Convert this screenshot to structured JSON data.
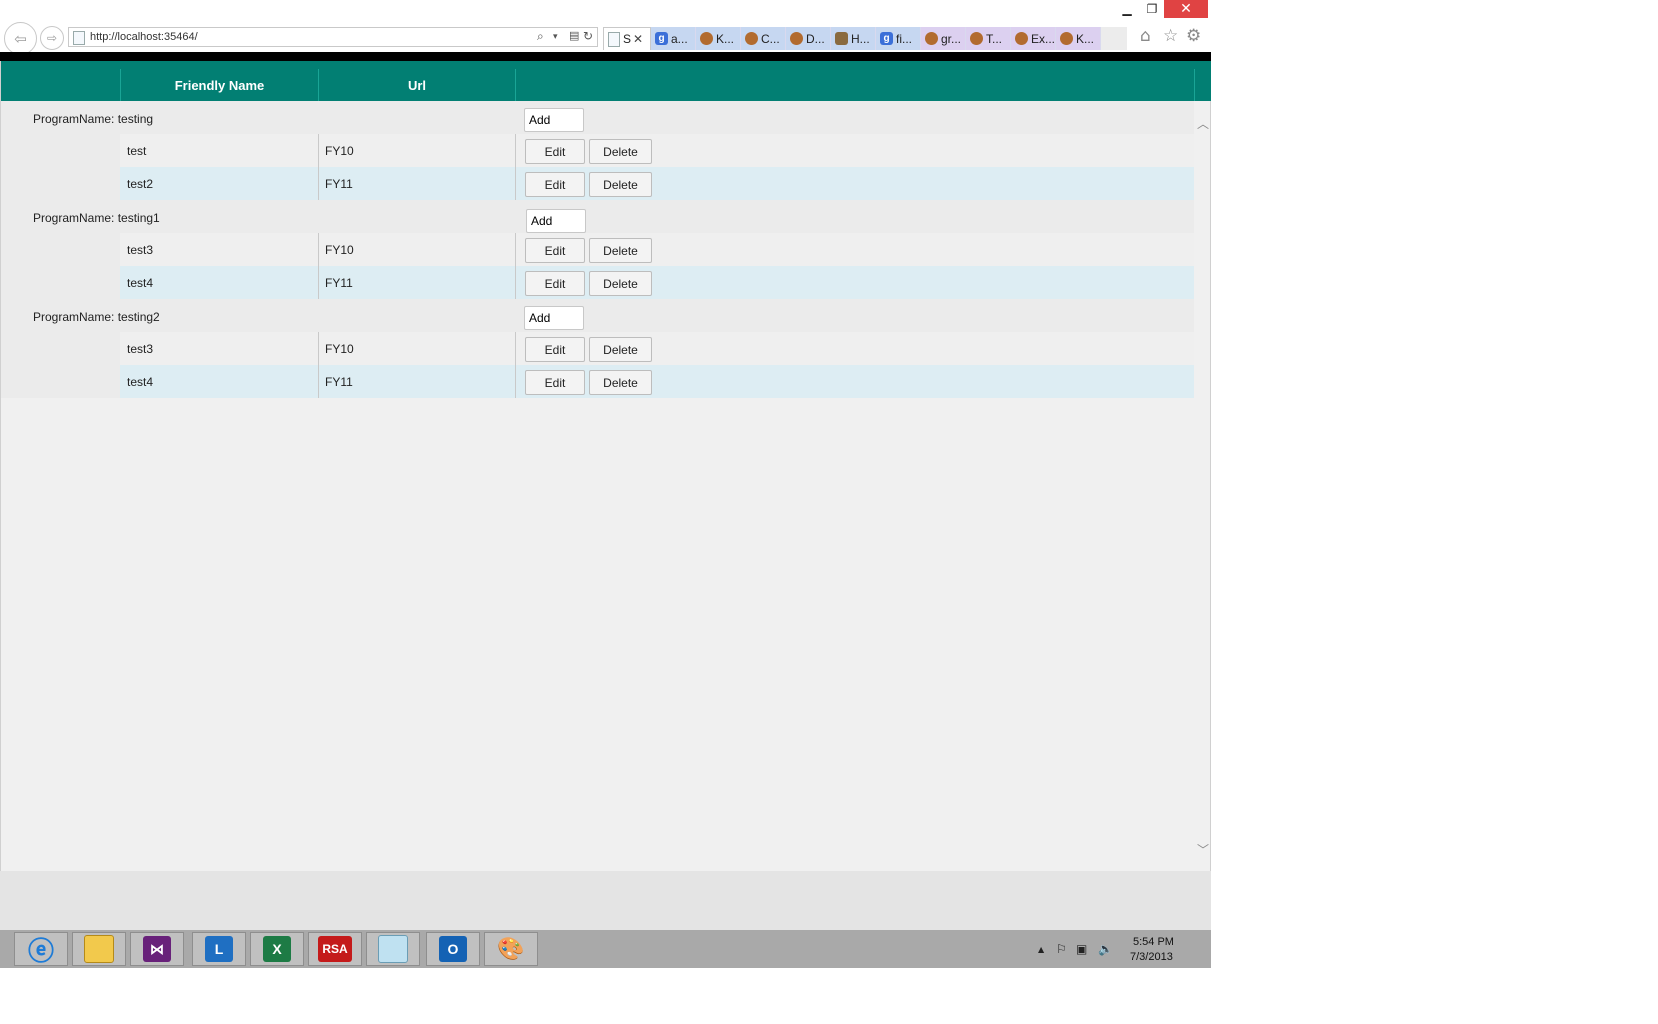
{
  "browser": {
    "url": "http://localhost:35464/",
    "tabs": [
      {
        "label": "S",
        "kind": "active"
      },
      {
        "label": "a...",
        "kind": "google"
      },
      {
        "label": "K...",
        "kind": "user"
      },
      {
        "label": "C...",
        "kind": "user"
      },
      {
        "label": "D...",
        "kind": "user"
      },
      {
        "label": "H...",
        "kind": "stack"
      },
      {
        "label": "fi...",
        "kind": "google"
      },
      {
        "label": "gr...",
        "kind": "user"
      },
      {
        "label": "T...",
        "kind": "user"
      },
      {
        "label": "Ex...",
        "kind": "user"
      },
      {
        "label": "K...",
        "kind": "user"
      }
    ],
    "colors": {
      "header": "#027f73",
      "alt_row": "#ddedf3",
      "close": "#e04343"
    }
  },
  "grid": {
    "columns": {
      "friendly_name": "Friendly Name",
      "url": "Url"
    },
    "add_label": "Add",
    "edit_label": "Edit",
    "delete_label": "Delete",
    "groups": [
      {
        "label": "ProgramName: testing",
        "rows": [
          {
            "name": "test",
            "url": "FY10"
          },
          {
            "name": "test2",
            "url": "FY11"
          }
        ]
      },
      {
        "label": "ProgramName: testing1",
        "rows": [
          {
            "name": "test3",
            "url": "FY10"
          },
          {
            "name": "test4",
            "url": "FY11"
          }
        ]
      },
      {
        "label": "ProgramName: testing2",
        "rows": [
          {
            "name": "test3",
            "url": "FY10"
          },
          {
            "name": "test4",
            "url": "FY11"
          }
        ]
      }
    ]
  },
  "taskbar": {
    "apps": [
      "internet-explorer",
      "file-explorer",
      "visual-studio",
      "lync",
      "excel",
      "rsa",
      "notepad",
      "outlook",
      "paint"
    ],
    "rsa_label": "RSA",
    "time": "5:54 PM",
    "date": "7/3/2013"
  }
}
